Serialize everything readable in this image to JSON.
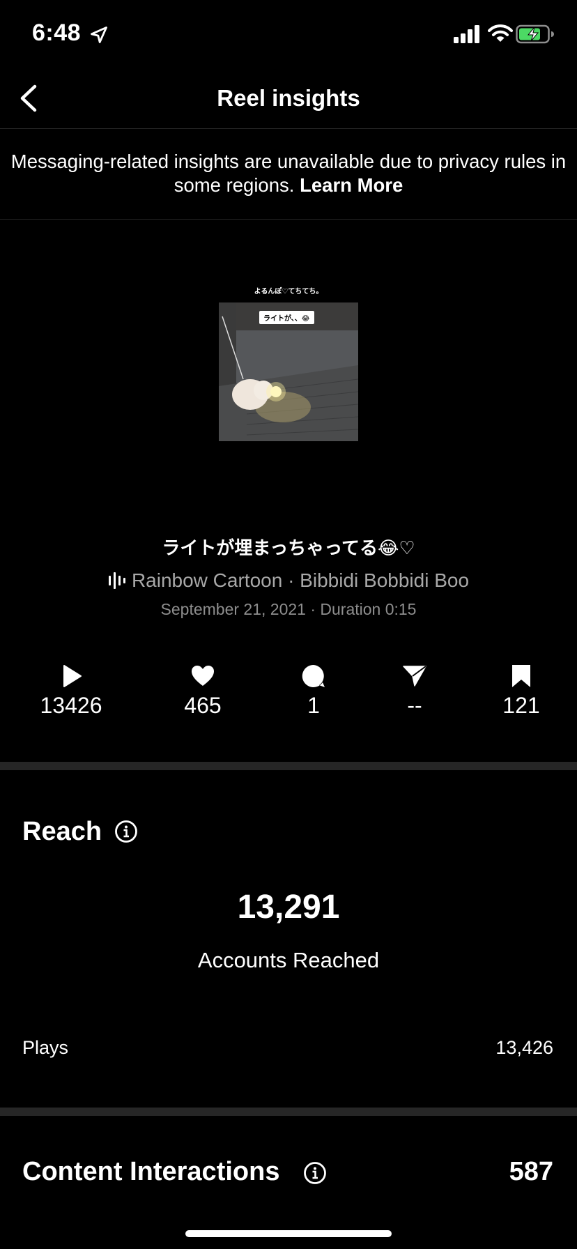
{
  "status_bar": {
    "time": "6:48"
  },
  "nav": {
    "title": "Reel insights"
  },
  "notice": {
    "text": "Messaging-related insights are unavailable due to privacy rules in some regions.",
    "link": "Learn More"
  },
  "reel": {
    "thumb_caption": "よるんぽ♡てちてち。",
    "thumb_label": "ライトが、、😂",
    "title": "ライトが埋まっちゃってる😂♡",
    "audio": "Rainbow Cartoon · Bibbidi Bobbidi Boo",
    "date_duration": "September 21, 2021 · Duration 0:15"
  },
  "stats": {
    "plays": "13426",
    "likes": "465",
    "comments": "1",
    "shares": "--",
    "saves": "121"
  },
  "reach": {
    "title": "Reach",
    "accounts_reached_value": "13,291",
    "accounts_reached_label": "Accounts Reached",
    "plays_label": "Plays",
    "plays_value": "13,426"
  },
  "content_interactions": {
    "title": "Content Interactions",
    "value": "587"
  },
  "colors": {
    "background": "#000000",
    "muted": "#a8a8a8",
    "divider": "#262626",
    "battery": "#4cd964"
  }
}
